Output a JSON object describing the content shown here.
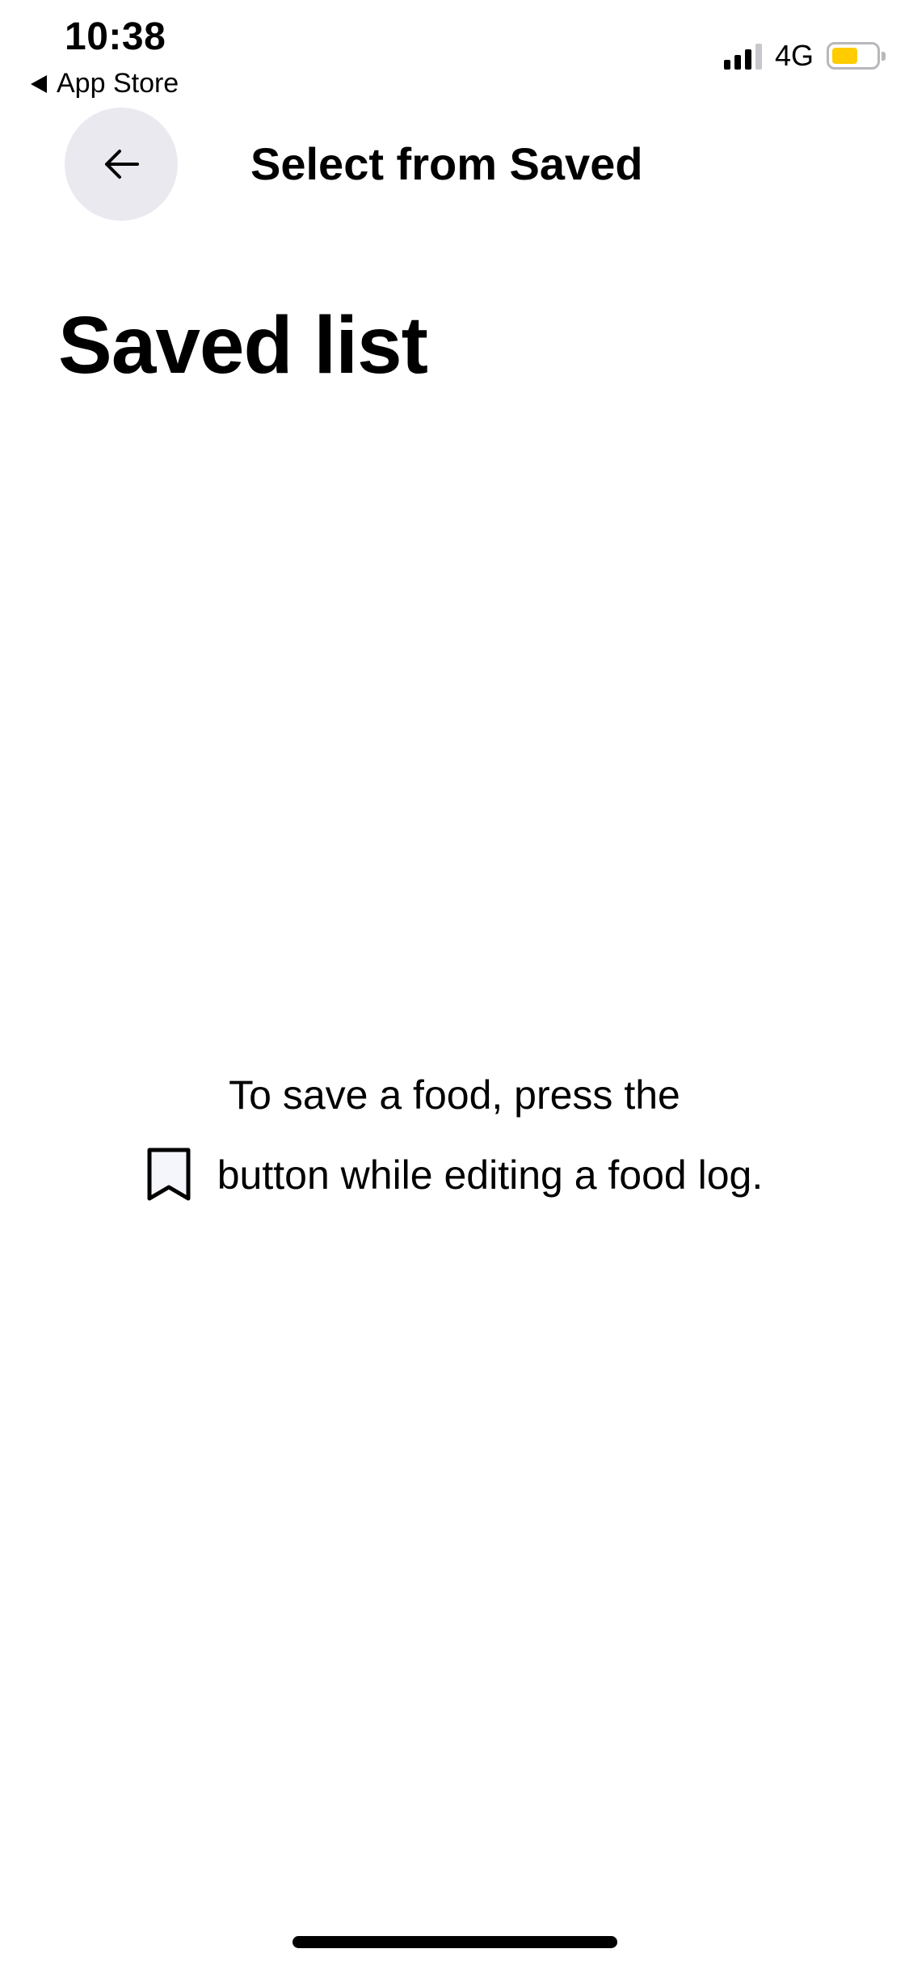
{
  "status_bar": {
    "time": "10:38",
    "back_app_label": "App Store",
    "network": "4G",
    "battery_color": "#ffcc00"
  },
  "header": {
    "back_icon": "arrow-left-icon",
    "title": "Select from Saved"
  },
  "main": {
    "title": "Saved list",
    "empty_state": {
      "line1": "To save a food, press the",
      "icon": "bookmark-icon",
      "line2": "button while editing a food log."
    }
  }
}
